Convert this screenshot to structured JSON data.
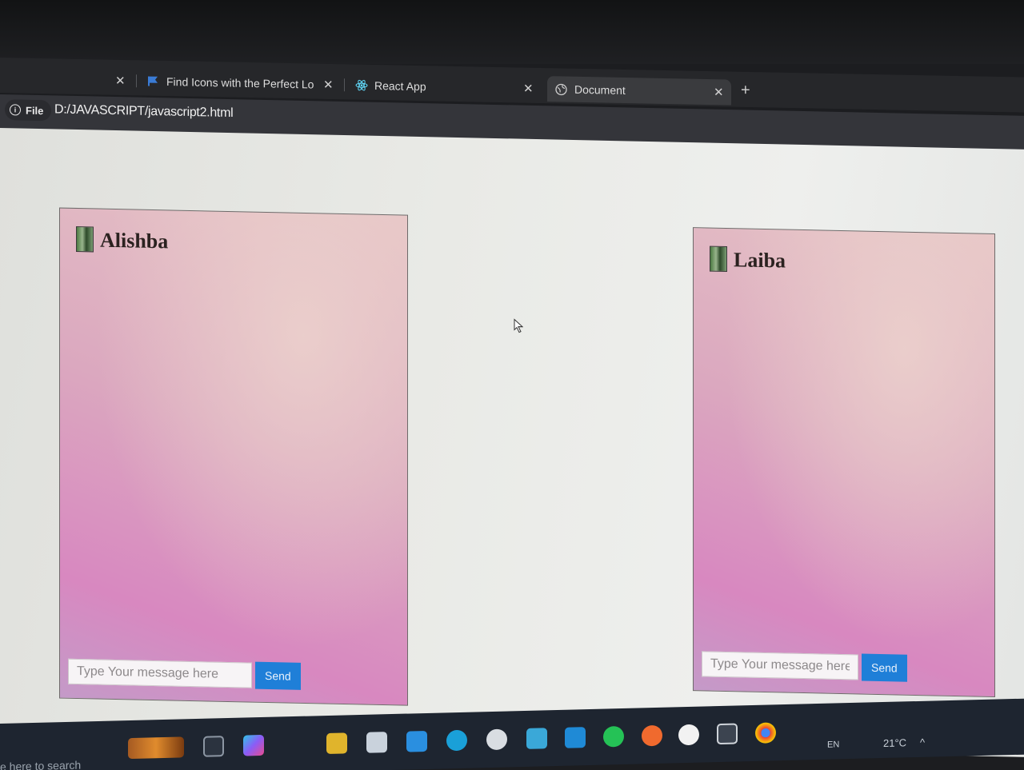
{
  "tabs": [
    {
      "label": "",
      "active": false
    },
    {
      "label": "Find Icons with the Perfect Look",
      "icon": "flag-icon",
      "active": false
    },
    {
      "label": "React App",
      "icon": "react-icon",
      "active": false
    },
    {
      "label": "Document",
      "icon": "globe-icon",
      "active": true
    }
  ],
  "address": {
    "scheme_label": "File",
    "url": "D:/JAVASCRIPT/javascript2.html"
  },
  "chats": [
    {
      "name": "Alishba",
      "placeholder": "Type Your message here",
      "send_label": "Send"
    },
    {
      "name": "Laiba",
      "placeholder": "Type Your message here",
      "send_label": "Send"
    }
  ],
  "taskbar": {
    "search_hint": "e here to search",
    "language": "EN",
    "temperature": "21°C"
  },
  "colors": {
    "send_button": "#1f7fd8",
    "chat_gradient_top": "#e6c4c6",
    "chat_gradient_bottom": "#d888c0"
  }
}
